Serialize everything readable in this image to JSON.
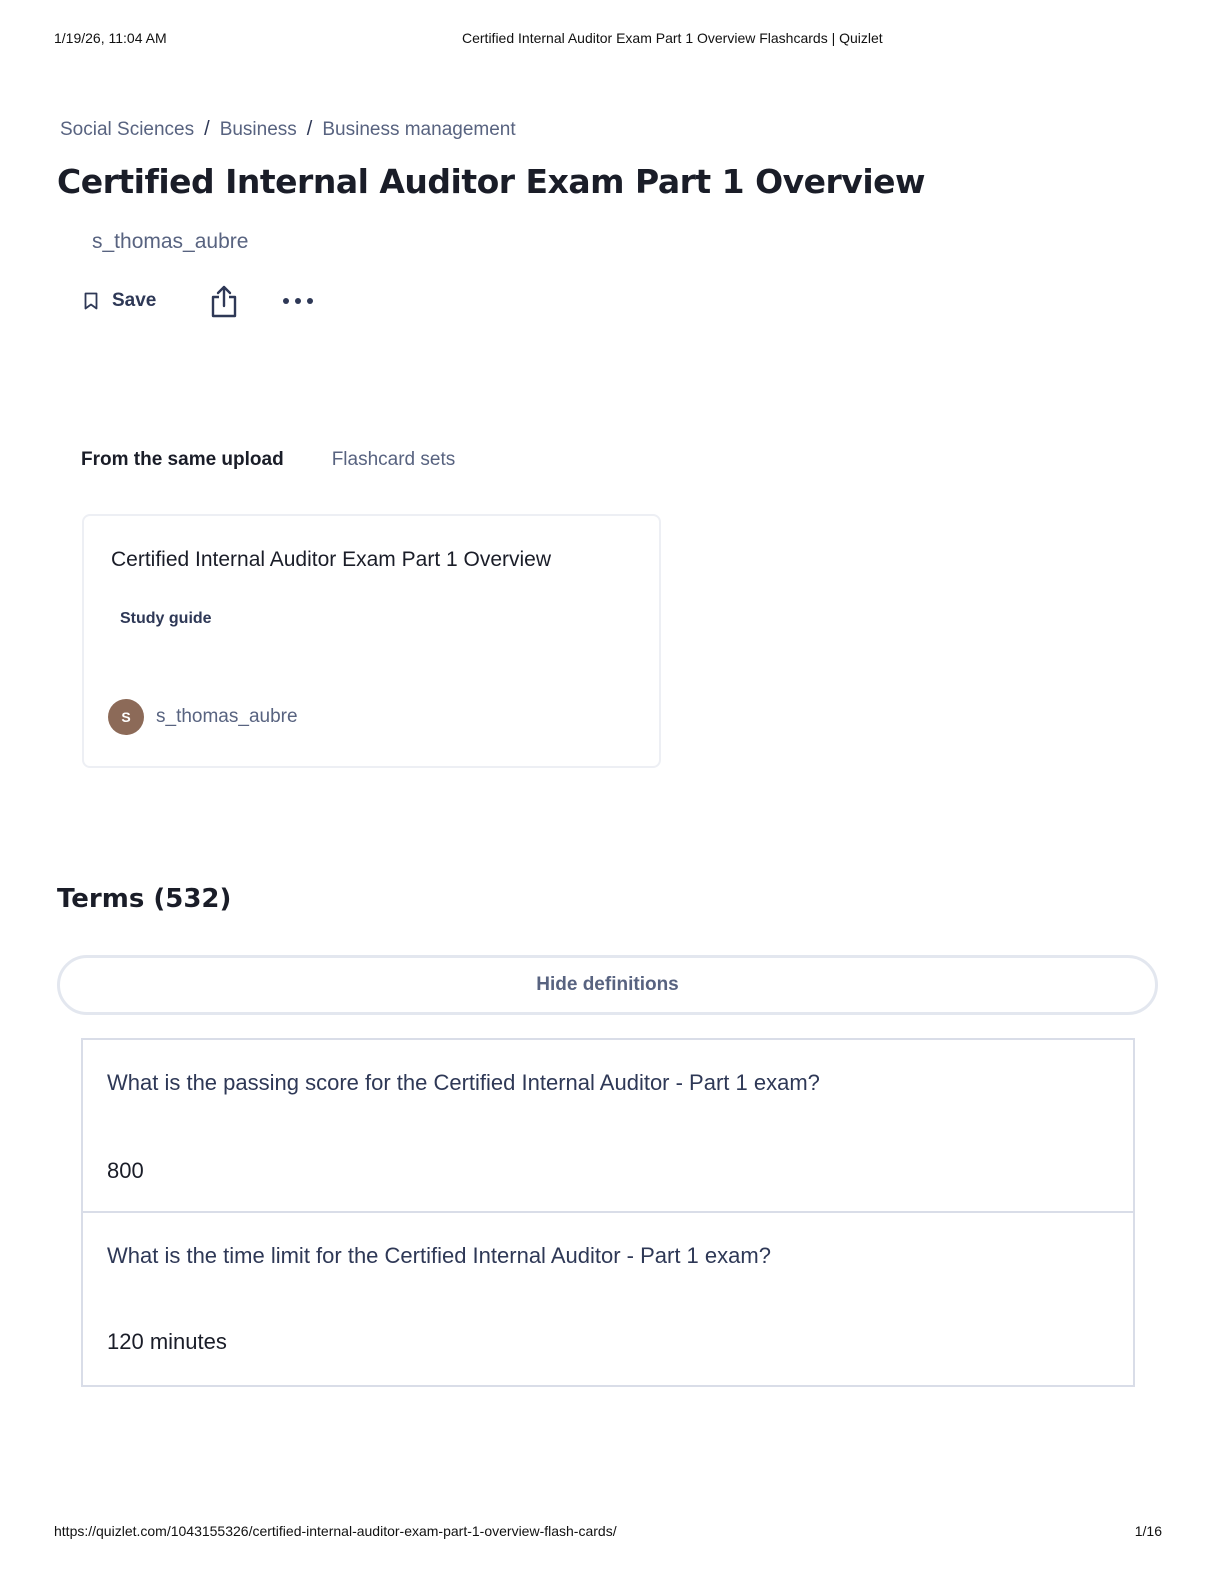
{
  "print_header": {
    "date": "1/19/26, 11:04 AM",
    "doc_title": "Certified Internal Auditor Exam Part 1 Overview Flashcards | Quizlet"
  },
  "breadcrumb": [
    "Social Sciences",
    "Business",
    "Business management"
  ],
  "breadcrumb_separator": "/",
  "title": "Certified Internal Auditor Exam Part 1 Overview",
  "author": "s_thomas_aubre",
  "actions": {
    "save_label": "Save",
    "save_icon": "bookmark-icon",
    "share_icon": "share-icon",
    "more_icon": "more-options-icon"
  },
  "upload_tabs": [
    "From the same upload",
    "Flashcard sets"
  ],
  "upload_card": {
    "title": "Certified Internal Auditor Exam Part 1 Overview",
    "type": "Study guide",
    "avatar_letter": "S",
    "avatar_color": "#8c6a58",
    "author": "s_thomas_aubre"
  },
  "terms": {
    "heading": "Terms (532)",
    "hide_definitions_label": "Hide definitions",
    "items": [
      {
        "term": "What is the passing score for the Certified Internal Auditor - Part 1 exam?",
        "definition": "800"
      },
      {
        "term": "What is the time limit for the Certified Internal Auditor - Part 1 exam?",
        "definition": "120 minutes"
      }
    ]
  },
  "print_footer": {
    "url": "https://quizlet.com/1043155326/certified-internal-auditor-exam-part-1-overview-flash-cards/",
    "page": "1/16"
  }
}
